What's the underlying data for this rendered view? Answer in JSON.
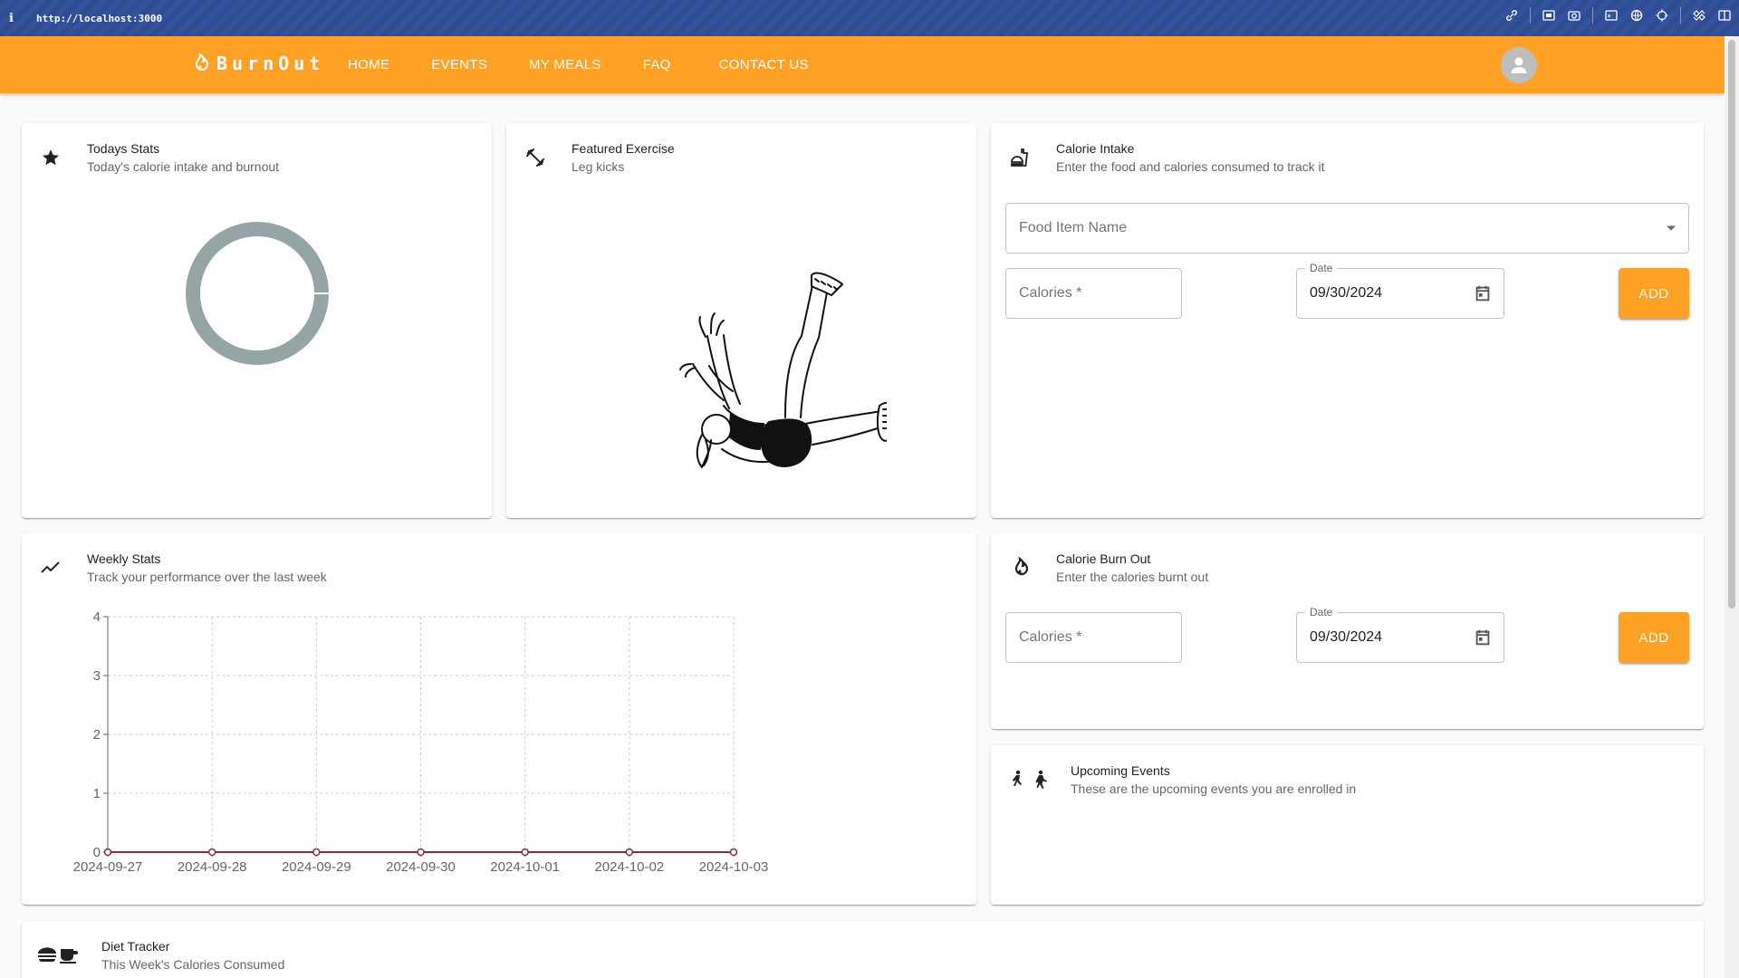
{
  "browser": {
    "url": "http://localhost:3000",
    "info_icon": "info-icon"
  },
  "header": {
    "brand": "BurnOut",
    "nav": [
      "HOME",
      "EVENTS",
      "MY MEALS",
      "FAQ",
      "CONTACT US"
    ],
    "accent": "#ffa124"
  },
  "todays_stats": {
    "title": "Todays Stats",
    "subtitle": "Today's calorie intake and burnout",
    "ring_color": "#95a5a6"
  },
  "featured_exercise": {
    "title": "Featured Exercise",
    "subtitle": "Leg kicks"
  },
  "calorie_intake": {
    "title": "Calorie Intake",
    "subtitle": "Enter the food and calories consumed to track it",
    "food_placeholder": "Food Item Name",
    "calories_placeholder": "Calories",
    "date_label": "Date",
    "date_value": "09/30/2024",
    "add_label": "ADD"
  },
  "weekly_stats": {
    "title": "Weekly Stats",
    "subtitle": "Track your performance over the last week"
  },
  "calorie_burnout": {
    "title": "Calorie Burn Out",
    "subtitle": "Enter the calories burnt out",
    "calories_placeholder": "Calories",
    "date_label": "Date",
    "date_value": "09/30/2024",
    "add_label": "ADD"
  },
  "upcoming_events": {
    "title": "Upcoming Events",
    "subtitle": "These are the upcoming events you are enrolled in"
  },
  "diet_tracker": {
    "title": "Diet Tracker",
    "subtitle": "This Week's Calories Consumed"
  },
  "chart_data": {
    "type": "line",
    "categories": [
      "2024-09-27",
      "2024-09-28",
      "2024-09-29",
      "2024-09-30",
      "2024-10-01",
      "2024-10-02",
      "2024-10-03"
    ],
    "series": [
      {
        "values": [
          0,
          0,
          0,
          0,
          0,
          0,
          0
        ],
        "color": "#8b2a3a"
      }
    ],
    "yticks": [
      "0",
      "1",
      "2",
      "3",
      "4"
    ],
    "ylim": [
      0,
      4
    ],
    "grid": true
  }
}
